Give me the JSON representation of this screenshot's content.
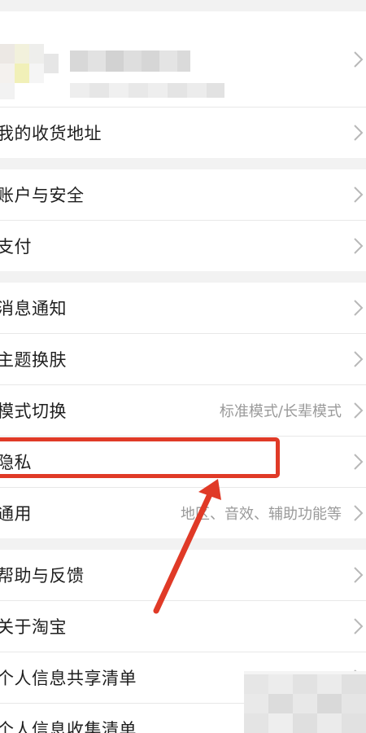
{
  "profile": {
    "avatar_icon": "avatar-pixelated",
    "chevron_icon": "chevron-right-icon"
  },
  "settings": {
    "address": "我的收货地址",
    "account_security": "账户与安全",
    "payment": "支付",
    "notifications": "消息通知",
    "theme": "主题换肤",
    "mode_switch": "模式切换",
    "mode_switch_value": "标准模式/长辈模式",
    "privacy": "隐私",
    "general": "通用",
    "general_value": "地区、音效、辅助功能等",
    "help_feedback": "帮助与反馈",
    "about": "关于淘宝",
    "personal_info_sharing": "个人信息共享清单",
    "personal_info_collection": "个人信息收集清单"
  },
  "colors": {
    "annotation": "#e03a27",
    "background": "#f2f2f2",
    "row": "#ffffff",
    "value_text": "#9a9a9a"
  }
}
